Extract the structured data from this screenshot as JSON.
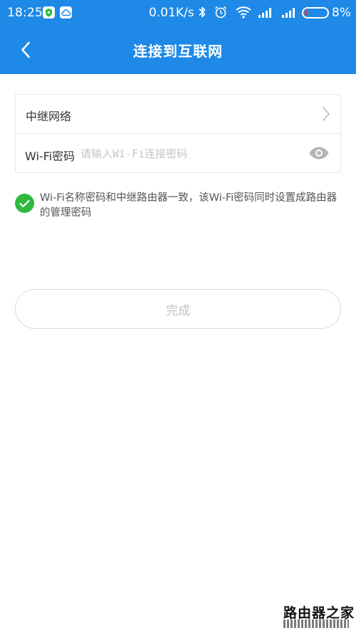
{
  "status_bar": {
    "time": "18:25",
    "net_speed": "0.01K/s",
    "battery_percent": "8%",
    "battery_level": 0.08,
    "accent_battery_low": "#e63535"
  },
  "header": {
    "title": "连接到互联网",
    "back_icon": "chevron-left-icon",
    "background": "#1e89e6"
  },
  "form": {
    "relay_network_label": "中继网络",
    "password_label": "Wi-Fi密码",
    "password_placeholder": "请输入Wi-Fi连接密码",
    "password_value": ""
  },
  "notice": {
    "checked": true,
    "text": "Wi-Fi名称密码和中继路由器一致，该Wi-Fi密码同时设置成路由器的管理密码",
    "check_color": "#2fb93e"
  },
  "actions": {
    "done_label": "完成"
  },
  "watermark": {
    "text": "路由器之家"
  }
}
